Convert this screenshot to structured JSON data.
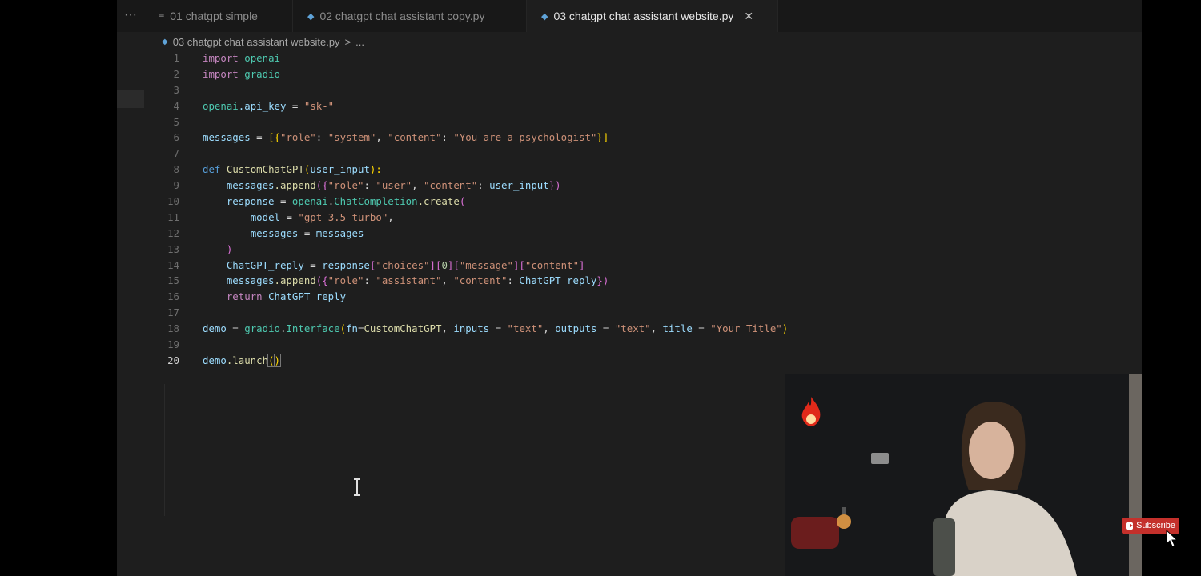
{
  "tabs": [
    {
      "label": "01 chatgpt simple",
      "icon": "text-file-icon",
      "active": false
    },
    {
      "label": "02 chatgpt chat assistant copy.py",
      "icon": "python-file-icon",
      "active": false
    },
    {
      "label": "03 chatgpt chat assistant website.py",
      "icon": "python-file-icon",
      "active": true
    }
  ],
  "tab_overflow": "···",
  "tab_close": "✕",
  "breadcrumb": {
    "file": "03 chatgpt chat assistant website.py",
    "separator": ">",
    "more": "..."
  },
  "line_numbers": [
    "1",
    "2",
    "3",
    "4",
    "5",
    "6",
    "7",
    "8",
    "9",
    "10",
    "11",
    "12",
    "13",
    "14",
    "15",
    "16",
    "17",
    "18",
    "19",
    "20"
  ],
  "current_line": "20",
  "code": {
    "l1": {
      "kw": "import",
      "mod": "openai"
    },
    "l2": {
      "kw": "import",
      "mod": "gradio"
    },
    "l4": {
      "obj": "openai",
      "attr": ".api_key",
      "eq": " = ",
      "str": "\"sk-\""
    },
    "l6": {
      "var": "messages",
      "eq": " = ",
      "open": "[{",
      "k1": "\"role\"",
      "c1": ": ",
      "v1": "\"system\"",
      "sep": ", ",
      "k2": "\"content\"",
      "c2": ": ",
      "v2": "\"You are a psychologist\"",
      "close": "}]"
    },
    "l8": {
      "kw": "def",
      "fn": "CustomChatGPT",
      "open": "(",
      "param": "user_input",
      "close": "):"
    },
    "l9": {
      "indent": "    ",
      "obj": "messages",
      "method": ".append",
      "open": "({",
      "k1": "\"role\"",
      "c1": ": ",
      "v1": "\"user\"",
      "sep": ", ",
      "k2": "\"content\"",
      "c2": ": ",
      "v2": "user_input",
      "close": "})"
    },
    "l10": {
      "indent": "    ",
      "var": "response",
      "eq": " = ",
      "obj": "openai",
      "dot": ".",
      "cls": "ChatCompletion",
      "method": ".create",
      "open": "("
    },
    "l11": {
      "indent": "        ",
      "var": "model",
      "eq": " = ",
      "str": "\"gpt-3.5-turbo\"",
      "comma": ","
    },
    "l12": {
      "indent": "        ",
      "var": "messages",
      "eq": " = ",
      "val": "messages"
    },
    "l13": {
      "indent": "    ",
      "close": ")"
    },
    "l14": {
      "indent": "    ",
      "var": "ChatGPT_reply",
      "eq": " = ",
      "obj": "response",
      "b1": "[",
      "s1": "\"choices\"",
      "b2": "][",
      "n": "0",
      "b3": "][",
      "s2": "\"message\"",
      "b4": "][",
      "s3": "\"content\"",
      "b5": "]"
    },
    "l15": {
      "indent": "    ",
      "obj": "messages",
      "method": ".append",
      "open": "({",
      "k1": "\"role\"",
      "c1": ": ",
      "v1": "\"assistant\"",
      "sep": ", ",
      "k2": "\"content\"",
      "c2": ": ",
      "v2": "ChatGPT_reply",
      "close": "})"
    },
    "l16": {
      "indent": "    ",
      "kw": "return",
      "val": " ChatGPT_reply"
    },
    "l18": {
      "var": "demo",
      "eq": " = ",
      "obj": "gradio",
      "dot": ".",
      "cls": "Interface",
      "open": "(",
      "a1": "fn",
      "e1": "=",
      "v1": "CustomChatGPT",
      "sep1": ", ",
      "a2": "inputs",
      "e2": " = ",
      "s2": "\"text\"",
      "sep2": ", ",
      "a3": "outputs",
      "e3": " = ",
      "s3": "\"text\"",
      "sep3": ", ",
      "a4": "title",
      "e4": " = ",
      "s4": "\"Your Title\"",
      "close": ")"
    },
    "l20": {
      "obj": "demo",
      "method": ".launch",
      "open": "(",
      "close": ")"
    }
  },
  "overlay": {
    "subscribe_label": "Subscribe"
  },
  "colors": {
    "editor_bg": "#1e1e1e",
    "keyword": "#c586c0",
    "function": "#dcdcaa",
    "class": "#4ec9b0",
    "string": "#ce9178",
    "variable": "#9cdcfe",
    "subscribe_red": "#c4302b"
  }
}
